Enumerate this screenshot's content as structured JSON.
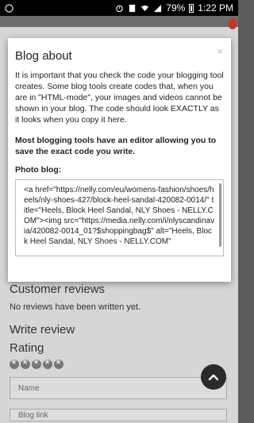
{
  "status_bar": {
    "battery": "79%",
    "time": "1:22 PM",
    "icons": [
      "whatsapp-icon",
      "alarm-icon",
      "sim-icon",
      "wifi-icon",
      "signal-icon",
      "battery-icon"
    ]
  },
  "modal": {
    "title": "Blog about",
    "close_label": "×",
    "body": "It is important that you check the code your blogging tool creates. Some blog tools create codes that, when you are in \"HTML-mode\", your images and videos cannot be shown in your blog. The code should look EXACTLY as it looks when you copy it here.",
    "bold_note": "Most blogging tools have an editor allowing you to save the exact code you write.",
    "photo_label": "Photo blog:",
    "code": "<a href=\"https://nelly.com/eu/womens-fashion/shoes/heels/nly-shoes-427/block-heel-sandal-420082-0014/\" title=\"Heels, Block Heel Sandal, NLY Shoes - NELLY.COM\"><img src=\"https://media.nelly.com/i/nlyscandinavia/420082-0014_01?$shoppingbag$\" alt=\"Heels, Block Heel Sandal, NLY Shoes - NELLY.COM\""
  },
  "reviews": {
    "heading": "Customer reviews",
    "empty_text": "No reviews have been written yet.",
    "write_heading": "Write review",
    "rating_label": "Rating",
    "name_placeholder": "Name",
    "blog_link_placeholder": "Blog link"
  },
  "colors": {
    "overlay": "#5b5b5b",
    "page": "#d6d6d6",
    "badge": "#c0392b",
    "scroll_button": "#2b2b2b"
  }
}
